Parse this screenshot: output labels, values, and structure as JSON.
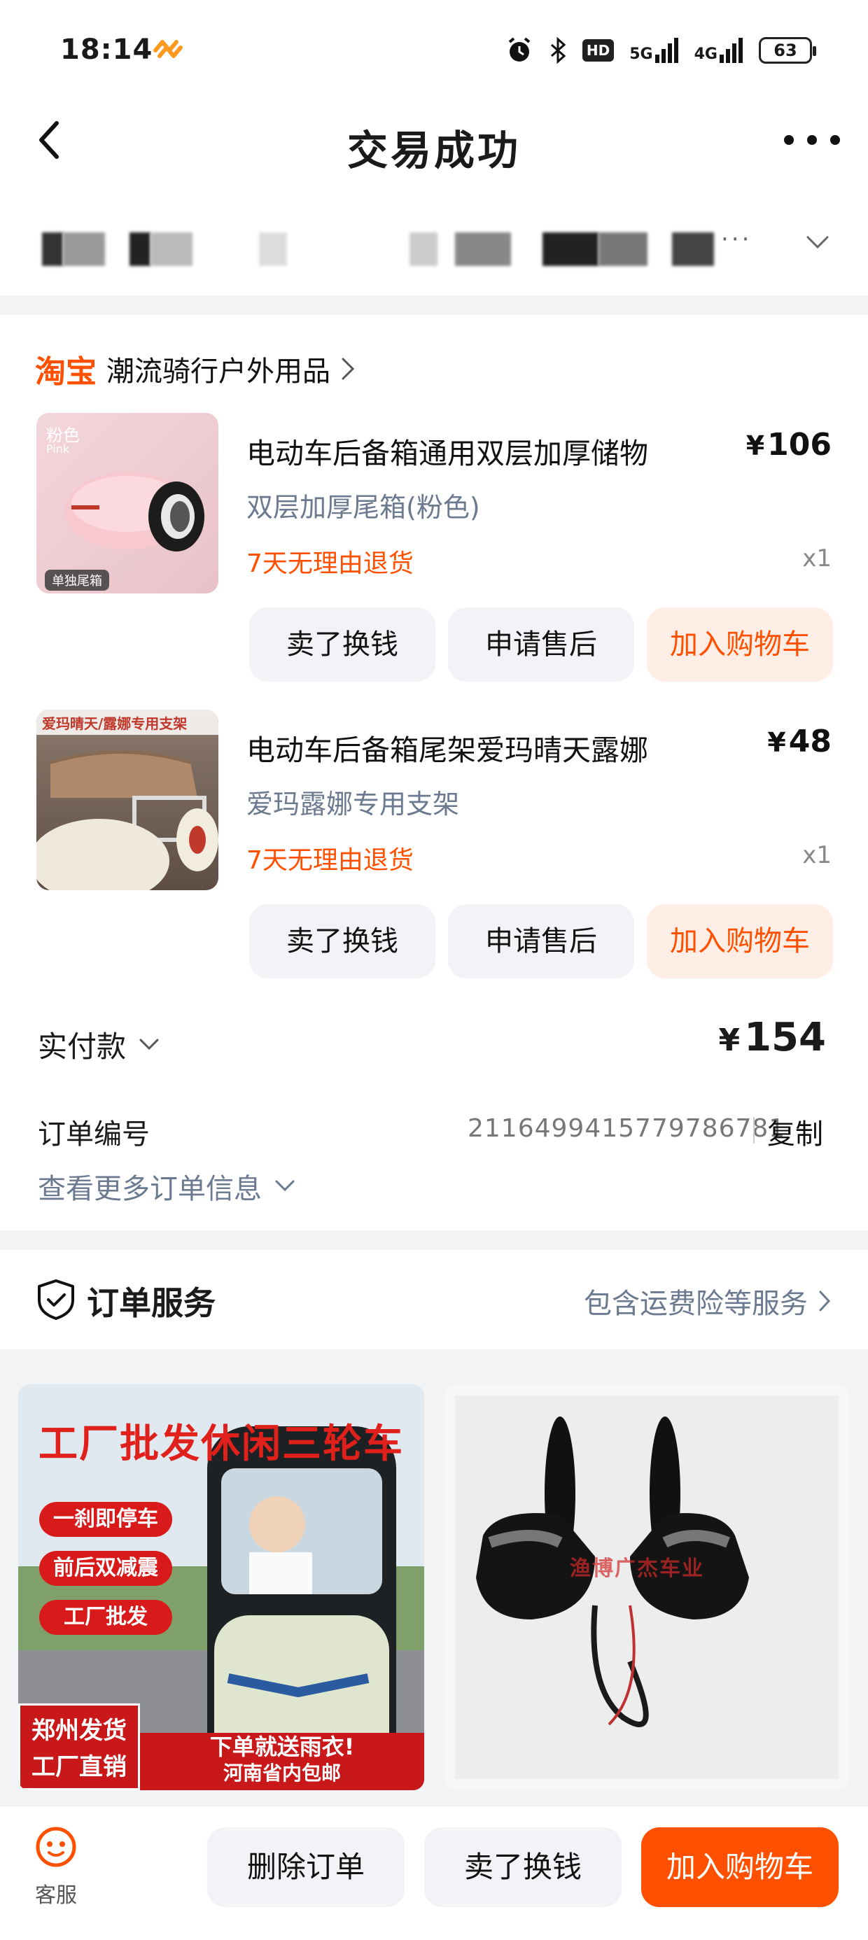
{
  "status_bar": {
    "time": "18:14",
    "network_1": "5G",
    "network_2": "4G",
    "hd_badge": "HD",
    "battery": "63"
  },
  "nav": {
    "title": "交易成功"
  },
  "address": {
    "ellipsis": "···"
  },
  "shop": {
    "logo": "淘宝",
    "name": "潮流骑行户外用品"
  },
  "items": [
    {
      "title": "电动车后备箱通用双层加厚储物",
      "price": "106",
      "spec": "双层加厚尾箱(粉色)",
      "return_policy": "7天无理由退货",
      "quantity": "x1",
      "thumb_label_top": "粉色",
      "thumb_label_sub": "Pink",
      "thumb_label_bottom": "单独尾箱"
    },
    {
      "title": "电动车后备箱尾架爱玛晴天露娜",
      "price": "48",
      "spec": "爱玛露娜专用支架",
      "return_policy": "7天无理由退货",
      "quantity": "x1",
      "thumb_label_top": "爱玛晴天/露娜专用支架"
    }
  ],
  "item_buttons": {
    "sell": "卖了换钱",
    "after_sale": "申请售后",
    "add_cart": "加入购物车"
  },
  "summary": {
    "paid_label": "实付款",
    "currency": "¥",
    "paid_amount": "154",
    "order_label": "订单编号",
    "order_number": "2116499415779786781",
    "copy": "复制",
    "more_info": "查看更多订单信息"
  },
  "service": {
    "title": "订单服务",
    "link": "包含运费险等服务"
  },
  "recommendations": {
    "left": {
      "title": "工厂批发休闲三轮车",
      "pills": [
        "一刹即停车",
        "前后双减震",
        "工厂批发"
      ],
      "badge_line1": "郑州发货",
      "badge_line2": "工厂直销",
      "banner_line1": "下单就送雨衣!",
      "banner_line2": "河南省内包邮"
    },
    "right": {
      "watermark": "渔博广杰车业"
    }
  },
  "bottom_bar": {
    "customer_service": "客服",
    "delete_order": "删除订单",
    "sell": "卖了换钱",
    "add_cart": "加入购物车"
  },
  "colors": {
    "accent": "#ff5000",
    "muted_text": "#6b7a90",
    "button_bg": "#f1f3f6",
    "section_bg": "#f2f3f5"
  }
}
